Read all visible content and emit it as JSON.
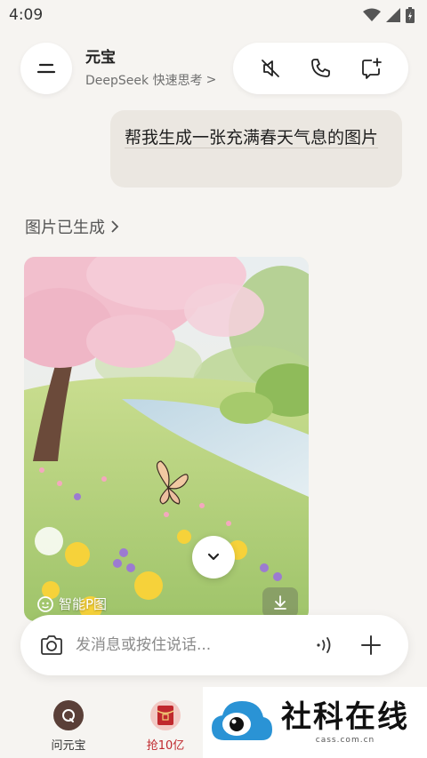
{
  "status": {
    "time": "4:09"
  },
  "header": {
    "title": "元宝",
    "subtitle": "DeepSeek 快速思考",
    "subtitle_chevron": ">"
  },
  "chat": {
    "user_message": "帮我生成一张充满春天气息的图片",
    "generated_label": "图片已生成",
    "image_badge": "智能P图"
  },
  "input": {
    "placeholder": "发消息或按住说话..."
  },
  "nav": {
    "items": [
      {
        "label": "问元宝",
        "icon": "yuanbao-icon"
      },
      {
        "label": "抢10亿",
        "icon": "red-envelope-icon",
        "color": "#c0282d"
      }
    ]
  },
  "watermark": {
    "title": "社科在线",
    "sub": "cass.com.cn"
  },
  "colors": {
    "background": "#f6f4f1",
    "bubble": "#ebe7e1",
    "accent_red": "#c0282d"
  }
}
